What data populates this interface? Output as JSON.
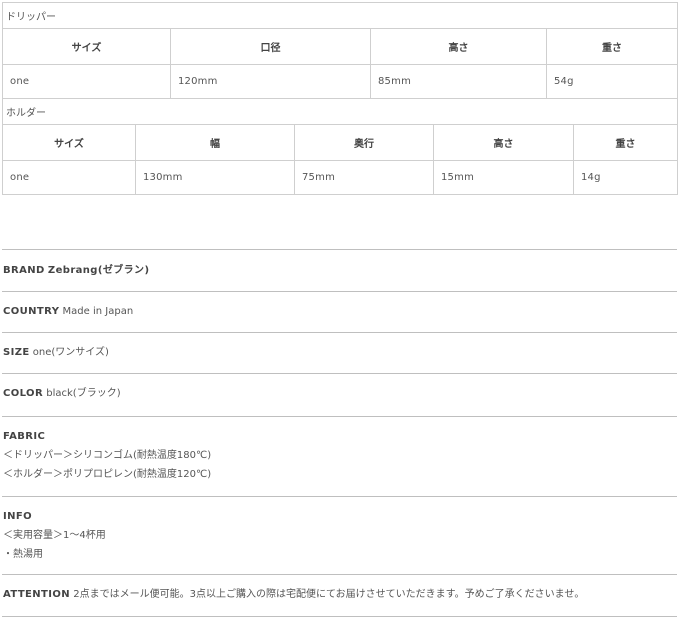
{
  "dripper": {
    "caption": "ドリッパー",
    "headers": [
      "サイズ",
      "口径",
      "高さ",
      "重さ"
    ],
    "values": [
      "one",
      "120mm",
      "85mm",
      "54g"
    ]
  },
  "holder": {
    "caption": "ホルダー",
    "headers": [
      "サイズ",
      "幅",
      "奥行",
      "高さ",
      "重さ"
    ],
    "values": [
      "one",
      "130mm",
      "75mm",
      "15mm",
      "14g"
    ]
  },
  "specs": {
    "brand": {
      "label": "BRAND",
      "value": "Zebrang(ゼブラン)"
    },
    "country": {
      "label": "COUNTRY",
      "value": "Made in Japan"
    },
    "size": {
      "label": "SIZE",
      "value": "one(ワンサイズ)"
    },
    "color": {
      "label": "COLOR",
      "value": "black(ブラック)"
    },
    "fabric": {
      "label": "FABRIC",
      "lines": [
        "＜ドリッパー＞シリコンゴム(耐熱温度180℃)",
        "＜ホルダー＞ポリプロピレン(耐熱温度120℃)"
      ]
    },
    "info": {
      "label": "INFO",
      "lines": [
        "＜実用容量＞1～4杯用",
        "・熱湯用"
      ]
    },
    "attention": {
      "label": "ATTENTION",
      "value": "2点まではメール便可能。3点以上ご購入の際は宅配便にてお届けさせていただきます。予めご了承くださいませ。"
    }
  }
}
